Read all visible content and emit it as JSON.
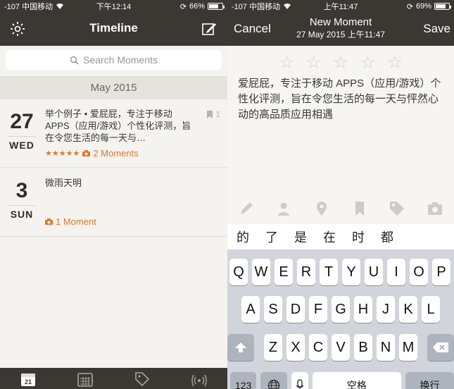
{
  "left": {
    "status": {
      "carrier": "-107 中国移动",
      "time": "下午12:14",
      "battery": "66%",
      "battery_level": 0.66
    },
    "nav": {
      "title": "Timeline"
    },
    "search": {
      "placeholder": "Search Moments"
    },
    "section": {
      "label": "May 2015"
    },
    "entries": [
      {
        "day": "27",
        "weekday": "WED",
        "text": "举个例子 • 爱屁屁，专注于移动 APPS（应用/游戏）个性化评测，旨在令您生活的每一天与…",
        "stars": "★★★★★",
        "moments": "2 Moments",
        "bookmark_count": "1"
      },
      {
        "day": "3",
        "weekday": "SUN",
        "text": "微雨天明",
        "moments": "1 Moment"
      }
    ],
    "tabs": [
      "calendar-day-tab",
      "calendar-month-tab",
      "tags-tab",
      "broadcast-tab"
    ],
    "tab_day": "21"
  },
  "right": {
    "status": {
      "carrier": "-107 中国移动",
      "time": "上午11:47",
      "battery": "69%",
      "battery_level": 0.69
    },
    "nav": {
      "cancel": "Cancel",
      "title": "New Moment",
      "subtitle": "27 May 2015 上午11:47",
      "save": "Save"
    },
    "stars": [
      "☆",
      "☆",
      "☆",
      "☆",
      "☆"
    ],
    "body": "爱屁屁，专注于移动 APPS（应用/游戏）个性化评测，旨在令您生活的每一天与怦然心动的高品质应用相遇",
    "candidates": [
      "的",
      "了",
      "是",
      "在",
      "时",
      "都"
    ],
    "keyboard": {
      "row1": [
        "Q",
        "W",
        "E",
        "R",
        "T",
        "Y",
        "U",
        "I",
        "O",
        "P"
      ],
      "row2": [
        "A",
        "S",
        "D",
        "F",
        "G",
        "H",
        "J",
        "K",
        "L"
      ],
      "row3": [
        "Z",
        "X",
        "C",
        "V",
        "B",
        "N",
        "M"
      ],
      "num_label": "123",
      "space_label": "空格",
      "return_label": "换行"
    }
  },
  "colors": {
    "nav": "#3b3733",
    "accent": "#e0762b",
    "bg": "#f4f3ef"
  }
}
